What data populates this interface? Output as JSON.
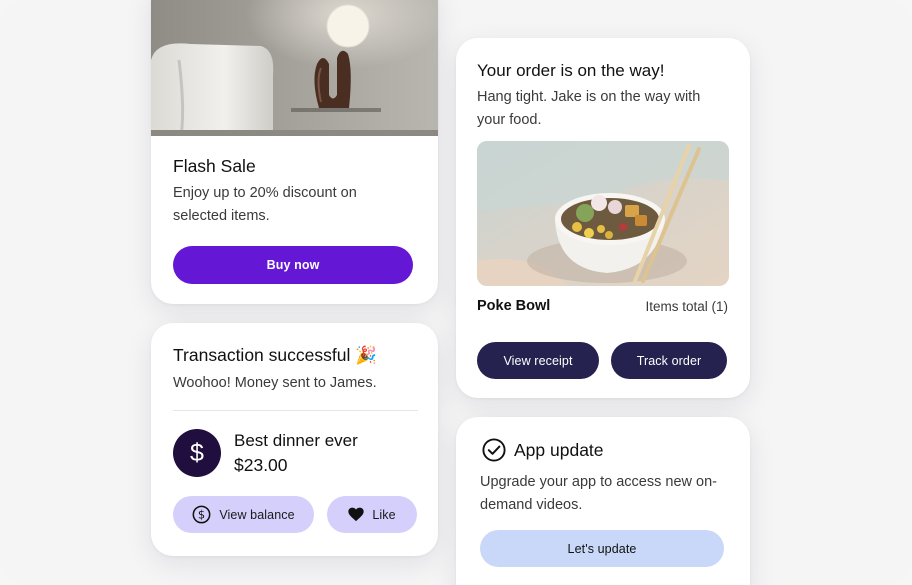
{
  "flash_sale": {
    "title": "Flash Sale",
    "body": "Enjoy up to 20% discount on selected items.",
    "button": "Buy now",
    "accent": "#6417d4"
  },
  "transaction": {
    "title": "Transaction successful 🎉",
    "body": "Woohoo! Money sent to James.",
    "avatar_symbol": "$",
    "item_name": "Best dinner ever",
    "amount": "$23.00",
    "balance_button": "View balance",
    "like_button": "Like",
    "button_color": "#d5cffb"
  },
  "order": {
    "title": "Your order is on the way!",
    "body": "Hang tight. Jake is on the way with your food.",
    "item_name": "Poke Bowl",
    "items_total": "Items total (1)",
    "receipt_button": "View receipt",
    "track_button": "Track order",
    "button_color": "#25224f"
  },
  "app_update": {
    "title": "App update",
    "body": "Upgrade your app to access new on-demand videos.",
    "button": "Let's update",
    "button_color": "#c9d8f8"
  },
  "icons": {
    "check": "check-circle-icon",
    "dollar": "dollar-circle-icon",
    "heart": "heart-icon"
  }
}
